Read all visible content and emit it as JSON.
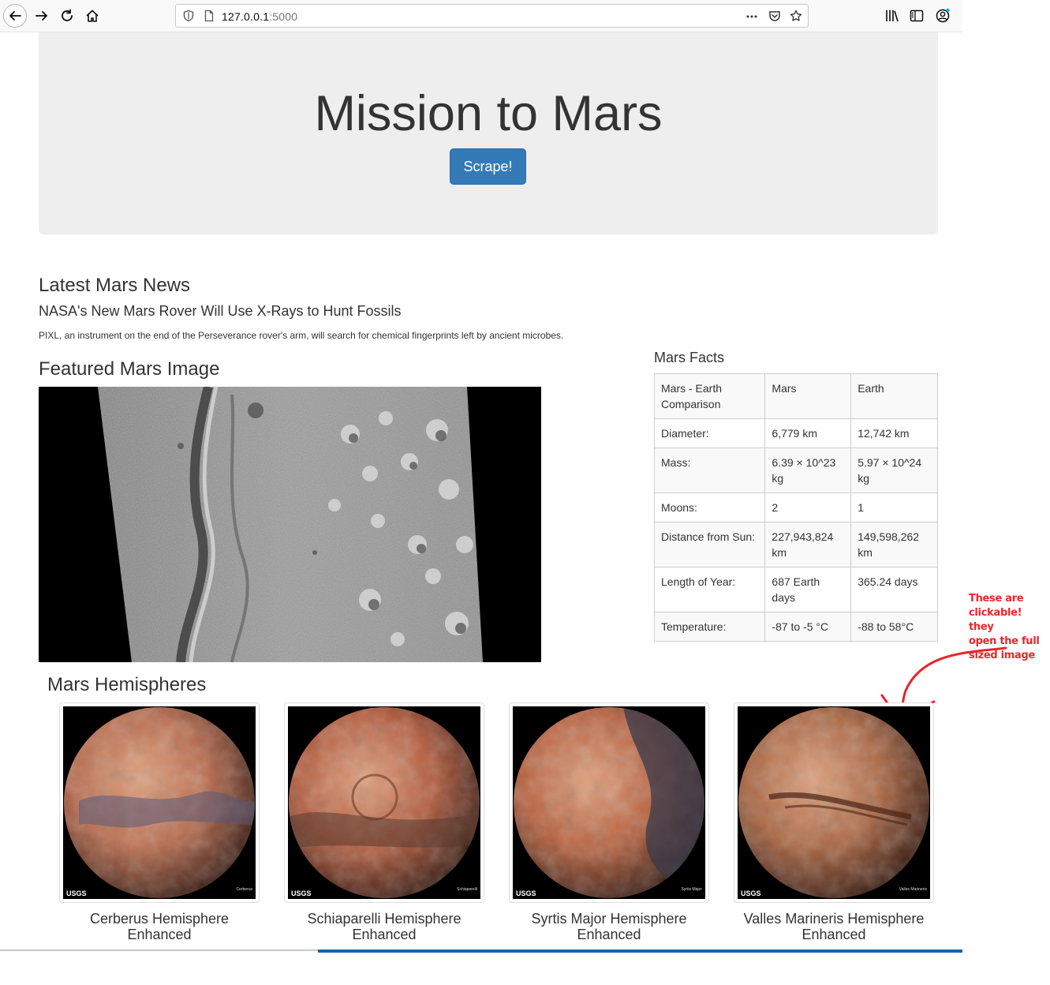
{
  "browser": {
    "url_host": "127.0.0.1",
    "url_port": ":5000",
    "icons": [
      "back-icon",
      "forward-icon",
      "reload-icon",
      "home-icon",
      "shield-icon",
      "page-icon",
      "more-icon",
      "pocket-icon",
      "star-icon",
      "library-icon",
      "sidebar-icon",
      "account-icon"
    ]
  },
  "jumbotron": {
    "title": "Mission to Mars",
    "button_label": "Scrape!"
  },
  "news": {
    "heading": "Latest Mars News",
    "title": "NASA's New Mars Rover Will Use X-Rays to Hunt Fossils",
    "paragraph": "PIXL, an instrument on the end of the Perseverance rover's arm, will search for chemical fingerprints left by ancient microbes."
  },
  "featured": {
    "heading": "Featured Mars Image"
  },
  "facts": {
    "heading": "Mars Facts",
    "header": [
      "Mars - Earth Comparison",
      "Mars",
      "Earth"
    ],
    "rows": [
      [
        "Diameter:",
        "6,779 km",
        "12,742 km"
      ],
      [
        "Mass:",
        "6.39 × 10^23 kg",
        "5.97 × 10^24 kg"
      ],
      [
        "Moons:",
        "2",
        "1"
      ],
      [
        "Distance from Sun:",
        "227,943,824 km",
        "149,598,262 km"
      ],
      [
        "Length of Year:",
        "687 Earth days",
        "365.24 days"
      ],
      [
        "Temperature:",
        "-87 to -5 °C",
        "-88 to 58°C"
      ]
    ]
  },
  "annotation": {
    "lines": [
      "These are",
      "clickable! they",
      "open the full",
      "sized image"
    ]
  },
  "hemispheres": {
    "heading": "Mars Hemispheres",
    "items": [
      {
        "title": "Cerberus Hemisphere Enhanced",
        "label": "Cerberus",
        "logo": "USGS",
        "base": "#b8694a",
        "dark": "#5a5a78"
      },
      {
        "title": "Schiaparelli Hemisphere Enhanced",
        "label": "Schiaparelli",
        "logo": "USGS",
        "base": "#b3593a",
        "dark": "#5a3a30"
      },
      {
        "title": "Syrtis Major Hemisphere Enhanced",
        "label": "Syrtis Major",
        "logo": "USGS",
        "base": "#b8603c",
        "dark": "#3a3a4a"
      },
      {
        "title": "Valles Marineris Hemisphere Enhanced",
        "label": "Valles Marineris",
        "logo": "USGS",
        "base": "#a9643f",
        "dark": "#5a3424"
      }
    ]
  },
  "colors": {
    "primary_button": "#337ab7",
    "jumbotron_bg": "#eeeeee",
    "annotation": "#e8262a"
  }
}
